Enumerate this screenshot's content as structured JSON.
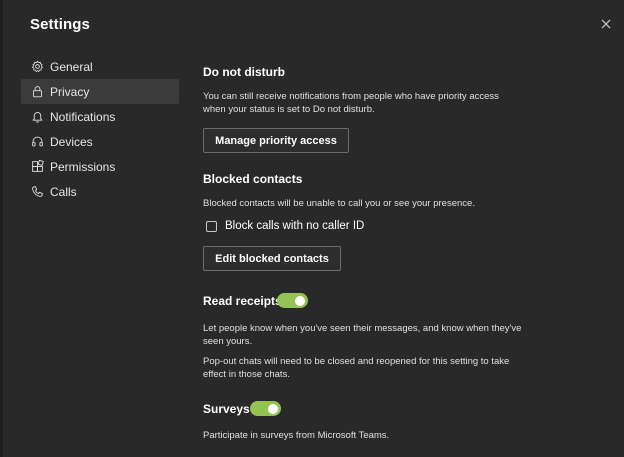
{
  "window": {
    "title": "Settings"
  },
  "sidebar": {
    "items": [
      {
        "label": "General",
        "icon": "gear-icon",
        "active": false
      },
      {
        "label": "Privacy",
        "icon": "lock-icon",
        "active": true
      },
      {
        "label": "Notifications",
        "icon": "bell-icon",
        "active": false
      },
      {
        "label": "Devices",
        "icon": "headset-icon",
        "active": false
      },
      {
        "label": "Permissions",
        "icon": "apps-icon",
        "active": false
      },
      {
        "label": "Calls",
        "icon": "phone-icon",
        "active": false
      }
    ]
  },
  "privacy": {
    "dnd": {
      "heading": "Do not disturb",
      "description": "You can still receive notifications from people who have priority access when your status is set to Do not disturb.",
      "button_label": "Manage priority access"
    },
    "blocked": {
      "heading": "Blocked contacts",
      "description": "Blocked contacts will be unable to call you or see your presence.",
      "checkbox_label": "Block calls with no caller ID",
      "checkbox_checked": false,
      "button_label": "Edit blocked contacts"
    },
    "read_receipts": {
      "heading": "Read receipts",
      "toggle_on": true,
      "description": "Let people know when you've seen their messages, and know when they've seen yours.",
      "note": "Pop-out chats will need to be closed and reopened for this setting to take effect in those chats."
    },
    "surveys": {
      "heading": "Surveys",
      "toggle_on": true,
      "description": "Participate in surveys from Microsoft Teams."
    }
  },
  "colors": {
    "background": "#292929",
    "toggle_on": "#92c353",
    "active_nav": "#3b3b3b"
  }
}
